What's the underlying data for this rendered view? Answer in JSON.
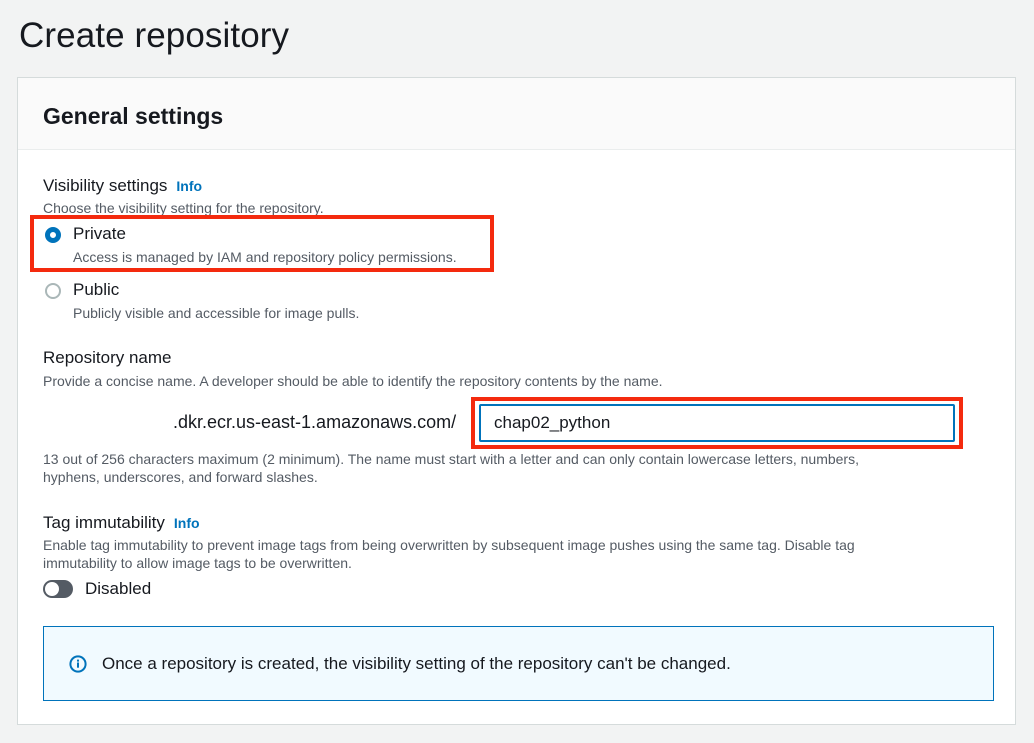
{
  "page": {
    "title": "Create repository"
  },
  "general_settings": {
    "title": "General settings"
  },
  "visibility": {
    "label": "Visibility settings",
    "info": "Info",
    "description": "Choose the visibility setting for the repository.",
    "options": [
      {
        "label": "Private",
        "description": "Access is managed by IAM and repository policy permissions.",
        "selected": true
      },
      {
        "label": "Public",
        "description": "Publicly visible and accessible for image pulls.",
        "selected": false
      }
    ]
  },
  "repository_name": {
    "label": "Repository name",
    "description": "Provide a concise name. A developer should be able to identify the repository contents by the name.",
    "prefix": ".dkr.ecr.us-east-1.amazonaws.com/",
    "value": "chap02_python",
    "constraint_line1": "13 out of 256 characters maximum (2 minimum). The name must start with a letter and can only contain lowercase letters, numbers,",
    "constraint_line2": "hyphens, underscores, and forward slashes."
  },
  "tag_immutability": {
    "label": "Tag immutability",
    "info": "Info",
    "description_line1": "Enable tag immutability to prevent image tags from being overwritten by subsequent image pushes using the same tag. Disable tag",
    "description_line2": "immutability to allow image tags to be overwritten.",
    "toggle_label": "Disabled",
    "enabled": false
  },
  "alert": {
    "icon": "info-circle-icon",
    "text": "Once a repository is created, the visibility setting of the repository can't be changed."
  },
  "colors": {
    "accent": "#0073bb",
    "highlight": "#f42a0e",
    "alert_background": "#f1faff"
  }
}
